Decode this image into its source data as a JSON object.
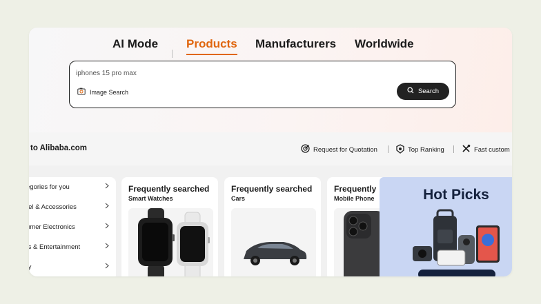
{
  "tabs": [
    {
      "label": "AI Mode",
      "active": false
    },
    {
      "label": "Products",
      "active": true
    },
    {
      "label": "Manufacturers",
      "active": false
    },
    {
      "label": "Worldwide",
      "active": false
    }
  ],
  "search": {
    "value": "iphones 15 pro max",
    "image_search_label": "Image Search",
    "button_label": "Search"
  },
  "bar": {
    "welcome": "to Alibaba.com",
    "links": [
      {
        "label": "Request for Quotation",
        "icon": "target-icon"
      },
      {
        "label": "Top Ranking",
        "icon": "medal-icon"
      },
      {
        "label": "Fast custom",
        "icon": "tools-icon"
      }
    ]
  },
  "categories": [
    "egories for you",
    "rel & Accessories",
    "umer Electronics",
    "ts & Entertainment",
    "ty"
  ],
  "cards": [
    {
      "title": "Frequently searched",
      "subtitle": "Smart Watches"
    },
    {
      "title": "Frequently searched",
      "subtitle": "Cars"
    },
    {
      "title": "Frequently",
      "subtitle": "Mobile Phone"
    }
  ],
  "hot_picks": {
    "title": "Hot Picks"
  },
  "colors": {
    "accent": "#e0660e",
    "dark": "#222222",
    "hot_bg": "#c9d6f3"
  }
}
